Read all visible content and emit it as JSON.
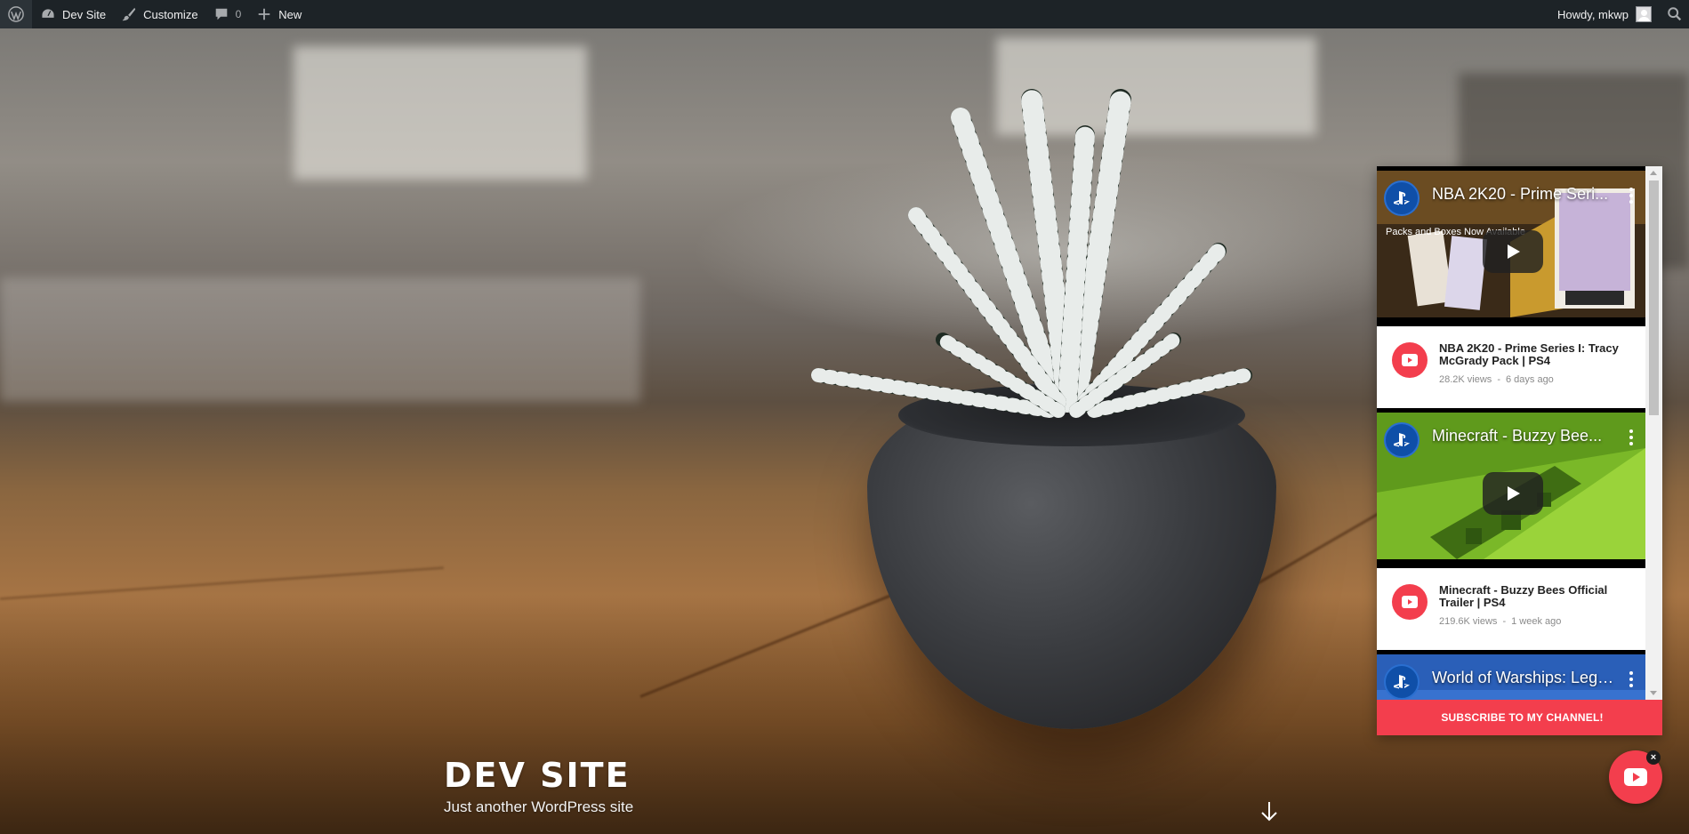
{
  "adminbar": {
    "wp_logo_icon": "wordpress-icon",
    "site_name": "Dev Site",
    "customize": "Customize",
    "comments_count": "0",
    "new_label": "New",
    "greeting": "Howdy, mkwp"
  },
  "hero": {
    "site_title": "DEV SITE",
    "tagline": "Just another WordPress site"
  },
  "youtube": {
    "accent_color": "#f33e4d",
    "videos": [
      {
        "thumb_title": "NBA 2K20 - Prime Seri...",
        "thumb_banner": "Packs and Boxes Now Available",
        "title": "NBA 2K20 - Prime Series I: Tracy McGrady Pack | PS4",
        "views": "28.2K views",
        "age": "6 days ago"
      },
      {
        "thumb_title": "Minecraft - Buzzy Bee...",
        "title": "Minecraft - Buzzy Bees Official Trailer | PS4",
        "views": "219.6K views",
        "age": "1 week ago"
      },
      {
        "thumb_title": "World of Warships: Legends"
      }
    ],
    "subscribe_label": "SUBSCRIBE TO MY CHANNEL!",
    "fab_close": "×"
  }
}
